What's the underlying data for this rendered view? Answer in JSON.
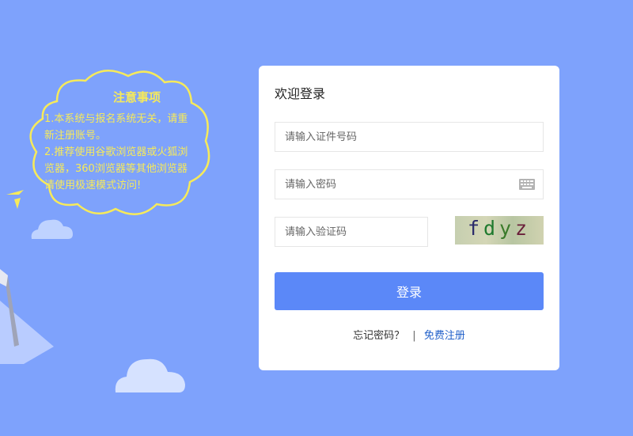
{
  "colors": {
    "background": "#7ea2fc",
    "notice_text": "#f6ea5a",
    "login_button": "#5b88f8",
    "register_link": "#1f5fc9"
  },
  "notice": {
    "title": "注意事项",
    "line1": "1.本系统与报名系统无关，请重新注册账号。",
    "line2": "2.推荐使用谷歌浏览器或火狐浏览器，360浏览器等其他浏览器请使用极速模式访问!"
  },
  "login": {
    "title": "欢迎登录",
    "id_placeholder": "请输入证件号码",
    "password_placeholder": "请输入密码",
    "captcha_placeholder": "请输入验证码",
    "captcha_text": "fdyz",
    "submit_label": "登录",
    "forgot_label": "忘记密码？",
    "separator": "|",
    "register_label": "免费注册",
    "keyboard_icon": "keyboard-icon"
  }
}
